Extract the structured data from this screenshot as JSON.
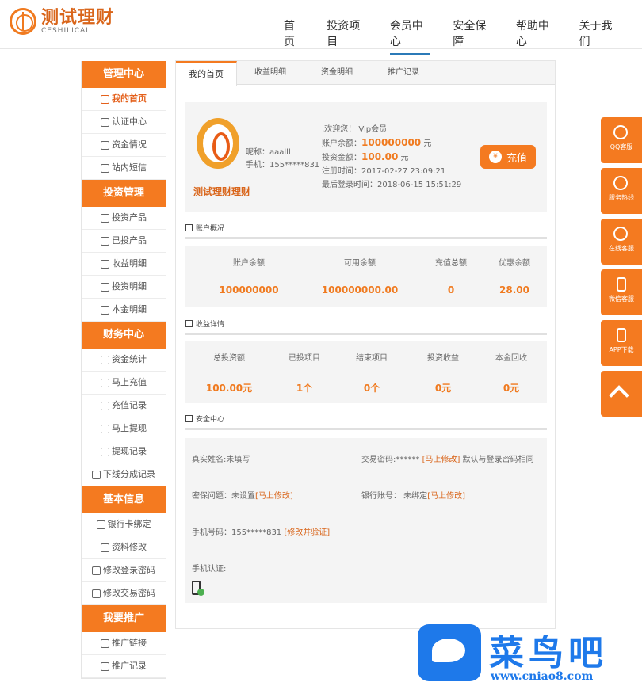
{
  "header": {
    "logo_cn": "测试理财",
    "logo_en": "CESHILICAI",
    "nav": [
      "首页",
      "投资项目",
      "会员中心",
      "安全保障",
      "帮助中心",
      "关于我们"
    ],
    "active_nav": "会员中心"
  },
  "sidebar": {
    "sections": [
      {
        "title": "管理中心",
        "items": [
          "我的首页",
          "认证中心",
          "资金情况",
          "站内短信"
        ]
      },
      {
        "title": "投资管理",
        "items": [
          "投资产品",
          "已投产品",
          "收益明细",
          "投资明细",
          "本金明细"
        ]
      },
      {
        "title": "财务中心",
        "items": [
          "资金统计",
          "马上充值",
          "充值记录",
          "马上提现",
          "提现记录",
          "下线分成记录"
        ]
      },
      {
        "title": "基本信息",
        "items": [
          "银行卡绑定",
          "资料修改",
          "修改登录密码",
          "修改交易密码"
        ]
      },
      {
        "title": "我要推广",
        "items": [
          "推广链接",
          "推广记录"
        ]
      }
    ]
  },
  "tabs": [
    "我的首页",
    "收益明细",
    "资金明细",
    "推广记录"
  ],
  "profile": {
    "brand": "测试理财理财",
    "nickname": "昵称：aaalll",
    "phone": "手机：155*****831",
    "welcome": ",欢迎您！ Vip会员",
    "balance_label": "账户余额：",
    "balance": "100000000",
    "balance_unit": "元",
    "invest_label": "投资金额：",
    "invest": "100.00",
    "invest_unit": "元",
    "reg_time": "注册时间：2017-02-27 23:09:21",
    "last_login": "最后登录时间：2018-06-15 15:51:29",
    "recharge_btn": "充值",
    "coin_symbol": "¥"
  },
  "account": {
    "title": "账户概况",
    "labels": [
      "账户余额",
      "可用余额",
      "充值总额",
      "优惠余额"
    ],
    "values": [
      "100000000",
      "100000000.00",
      "0",
      "28.00"
    ]
  },
  "earnings": {
    "title": "收益详情",
    "labels": [
      "总投资额",
      "已投项目",
      "结束项目",
      "投资收益",
      "本金回收"
    ],
    "values": [
      "100.00元",
      "1个",
      "0个",
      "0元",
      "0元"
    ]
  },
  "security": {
    "title": "安全中心",
    "realname": "真实姓名:未填写",
    "trade_pwd": "交易密码:****** ",
    "trade_pwd_link": "[马上修改]",
    "trade_pwd_note": " 默认与登录密码相同",
    "question": "密保问题：未设置",
    "question_link": "[马上修改]",
    "bank": "银行账号： 未绑定",
    "bank_link": "[马上修改]",
    "mobile": "手机号码：155*****831 ",
    "mobile_link": "[修改并验证]",
    "mobile_auth": "手机认证:"
  },
  "side_tools": [
    "QQ客服",
    "服务热线",
    "在线客服",
    "微信客服",
    "APP下载"
  ],
  "watermark": {
    "cn": "菜鸟吧",
    "url": "www.cniao8.com"
  }
}
